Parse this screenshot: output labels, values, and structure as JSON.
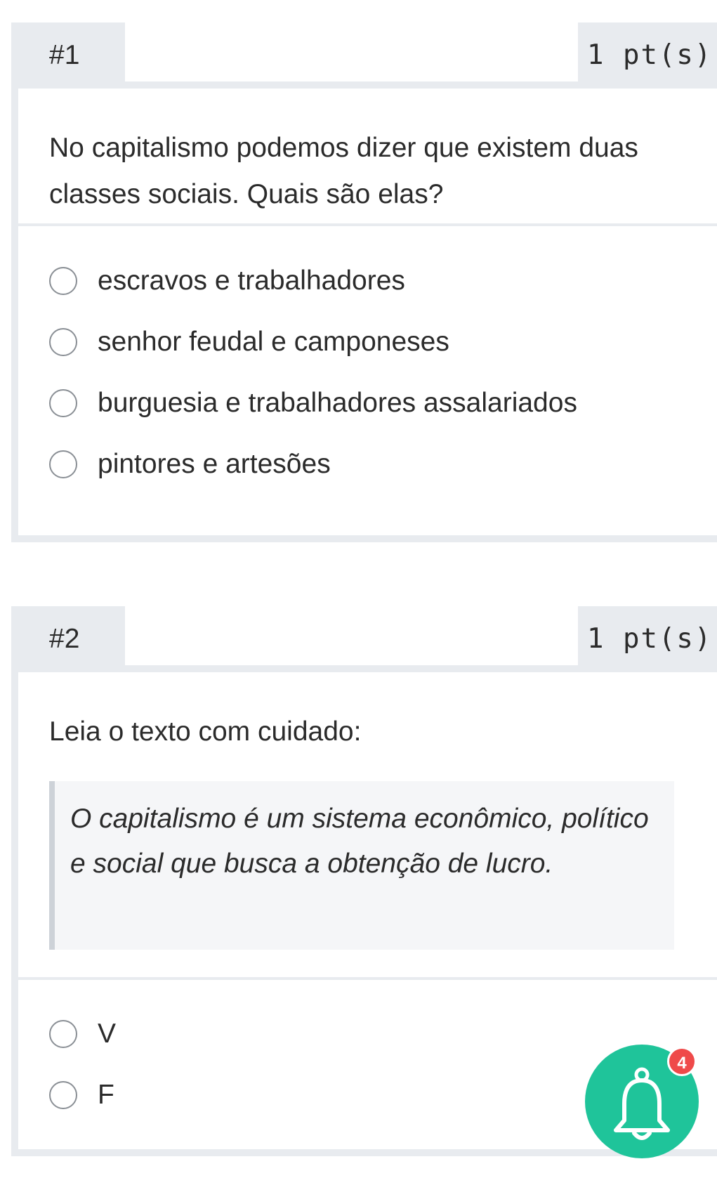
{
  "questions": [
    {
      "number": "#1",
      "points": "1 pt(s)",
      "prompt": "No capitalismo podemos dizer que existem duas classes sociais. Quais são elas?",
      "options": [
        "escravos e trabalhadores",
        "senhor feudal e camponeses",
        "burguesia e trabalhadores assalariados",
        "pintores e artesões"
      ]
    },
    {
      "number": "#2",
      "points": "1 pt(s)",
      "prompt": "Leia o texto com cuidado:",
      "quote": "O capitalismo é um sistema econômico, político e social que busca a obtenção de lucro.",
      "options": [
        "V",
        "F"
      ]
    }
  ],
  "notifications": {
    "icon": "bell-icon",
    "count": "4",
    "button_color": "#1fc49a",
    "badge_color": "#ef4a4a"
  }
}
